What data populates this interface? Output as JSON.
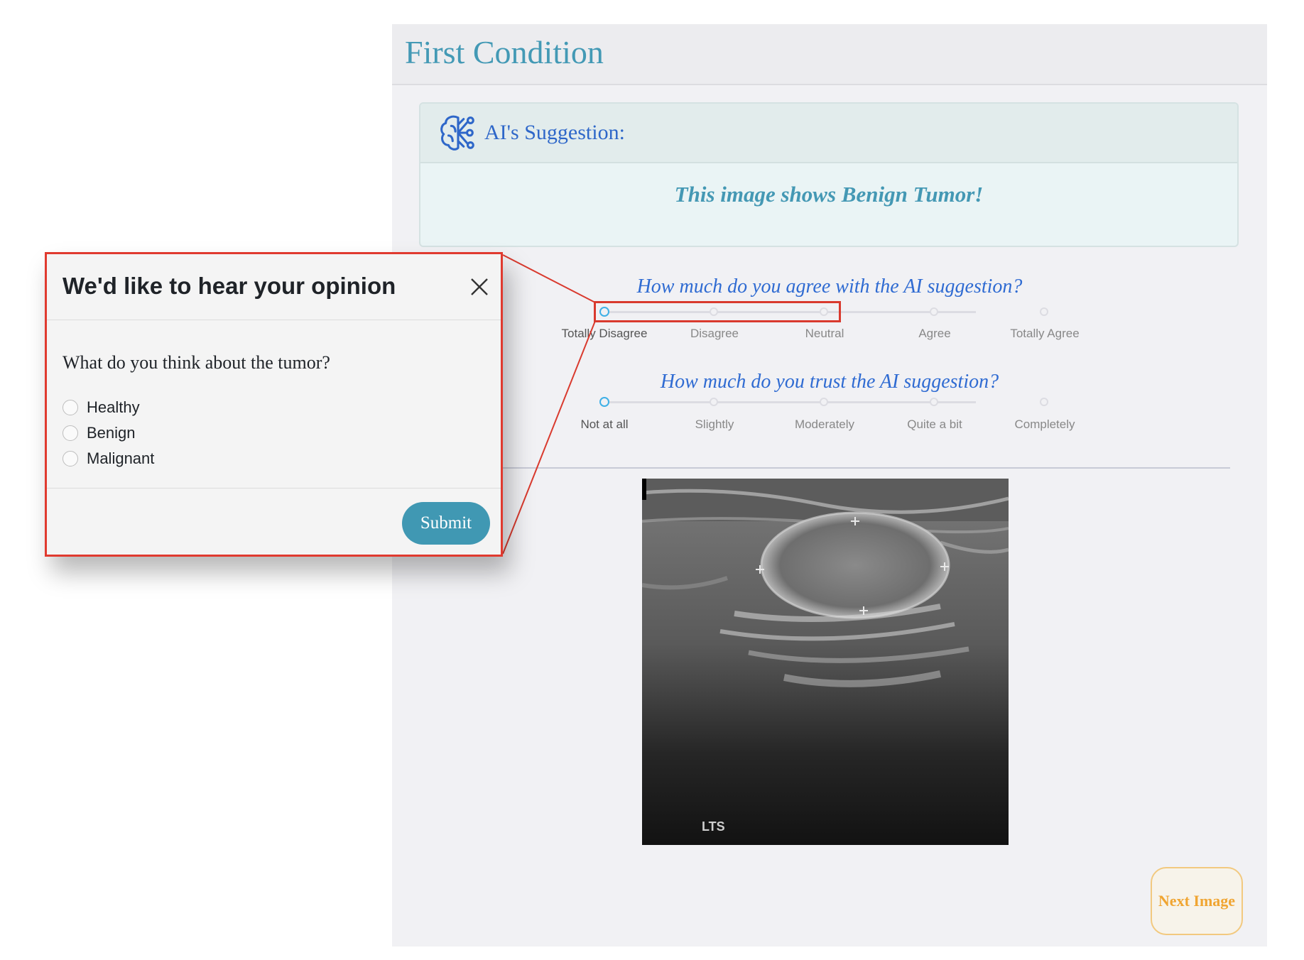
{
  "app": {
    "title": "First Condition",
    "suggestion": {
      "heading": "AI's Suggestion:",
      "text": "This image shows Benign Tumor!",
      "icon": "brain-circuit-icon"
    },
    "agree_question": "How much do you agree with the AI suggestion?",
    "agree_scale": {
      "options": [
        "Totally Disagree",
        "Disagree",
        "Neutral",
        "Agree",
        "Totally Agree"
      ],
      "selected": "Totally Disagree"
    },
    "trust_question": "How much do you trust the AI suggestion?",
    "trust_scale": {
      "options": [
        "Not at all",
        "Slightly",
        "Moderately",
        "Quite a bit",
        "Completely"
      ],
      "selected": "Not at all"
    },
    "image_label": "LTS",
    "next_button": "Next Image"
  },
  "modal": {
    "title": "We'd like to hear your opinion",
    "question": "What do you think about the tumor?",
    "options": [
      "Healthy",
      "Benign",
      "Malignant"
    ],
    "submit_label": "Submit"
  },
  "colors": {
    "title": "#4399b5",
    "heading_blue": "#2e67c9",
    "highlight_red": "#e03a2f",
    "submit": "#4098b3",
    "next_button": "#f0a532"
  }
}
